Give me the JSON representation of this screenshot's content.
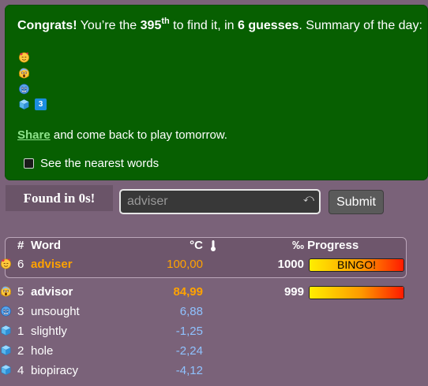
{
  "result": {
    "congrats_label": "Congrats!",
    "text_before_rank": " You’re the ",
    "rank": "395",
    "rank_suffix": "th",
    "text_before_guesses": " to find it, in ",
    "guesses": "6 guesses",
    "summary_label": ". Summary of the day:",
    "summary_icons": [
      "face-with-hearts-icon",
      "screaming-face-icon",
      "cold-face-icon",
      "ice-cube-icon"
    ],
    "summary_extra": "3",
    "share_label": "Share",
    "share_rest": " and come back to play tomorrow.",
    "nearest_label": "See the nearest words"
  },
  "game": {
    "found_text": "Found in 0s!",
    "input_value": "adviser",
    "submit_label": "Submit"
  },
  "table": {
    "headers": {
      "num": "#",
      "word": "Word",
      "temp": "°C",
      "thermo_icon": "thermometer-icon",
      "progress": "‰ Progress"
    },
    "latest": {
      "num": "6",
      "word": "adviser",
      "temp": "100,00",
      "icon": "face-with-hearts-icon",
      "progress": "1000",
      "bar_label": "BINGO!",
      "bar_fraction": 1.0
    },
    "rows": [
      {
        "num": "5",
        "word": "advisor",
        "temp": "84,99",
        "icon": "screaming-face-icon",
        "progress": "999",
        "bar_fraction": 0.999,
        "color": "gold"
      },
      {
        "num": "3",
        "word": "unsought",
        "temp": "6,88",
        "icon": "cold-face-icon",
        "progress": "",
        "color": "blue"
      },
      {
        "num": "1",
        "word": "slightly",
        "temp": "-1,25",
        "icon": "ice-cube-icon",
        "progress": "",
        "color": "blue"
      },
      {
        "num": "2",
        "word": "hole",
        "temp": "-2,24",
        "icon": "ice-cube-icon",
        "progress": "",
        "color": "blue"
      },
      {
        "num": "4",
        "word": "biopiracy",
        "temp": "-4,12",
        "icon": "ice-cube-icon",
        "progress": "",
        "color": "blue"
      }
    ]
  },
  "colors": {
    "panel": "#075f01",
    "background": "#7a6279",
    "hot": "#ffa200",
    "cold": "#8fc2ff"
  }
}
